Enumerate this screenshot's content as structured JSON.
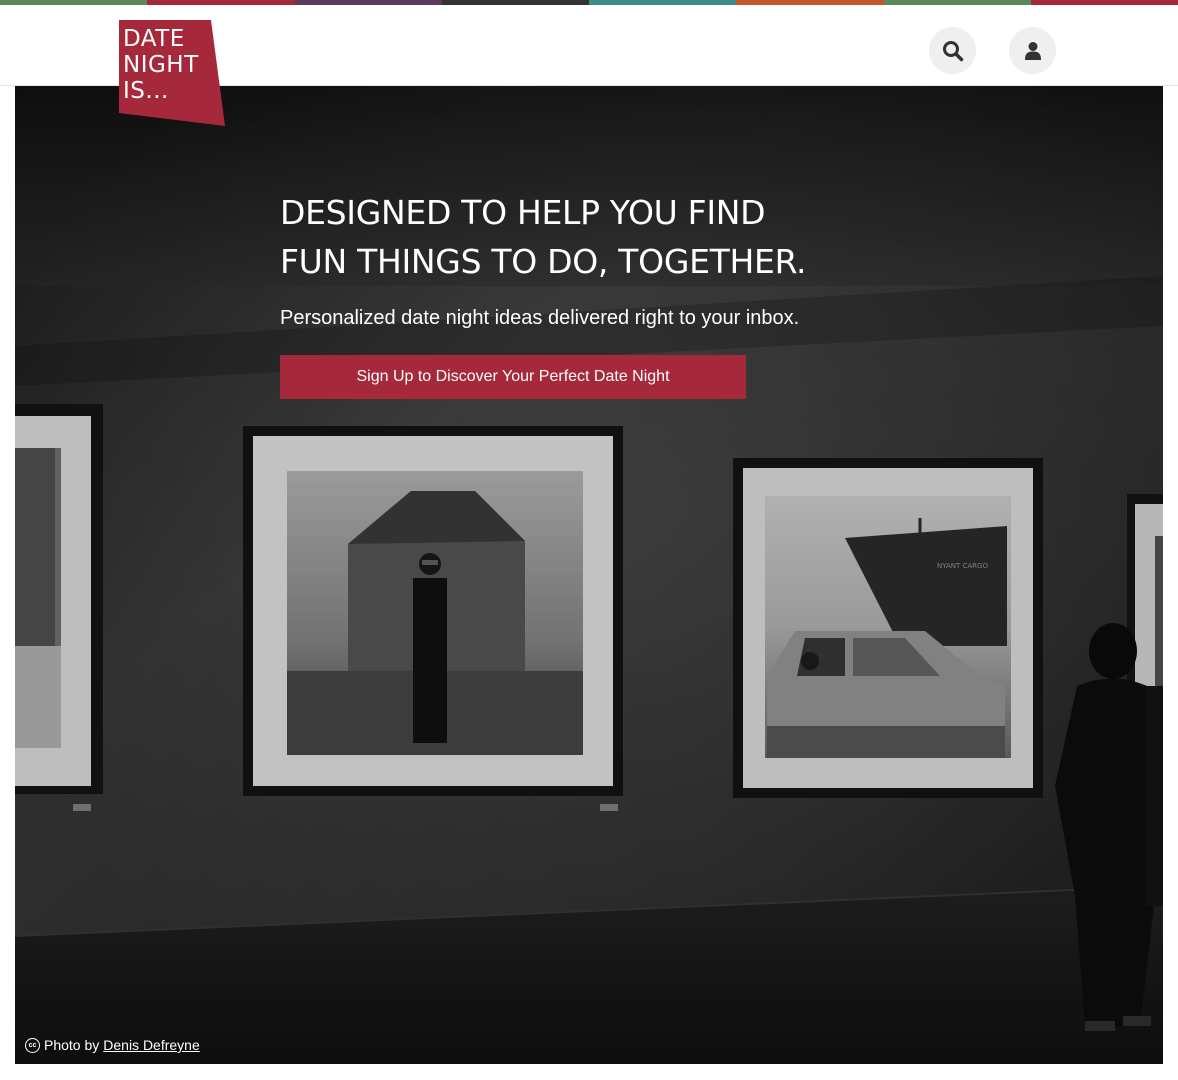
{
  "colors": {
    "brand": "#a6293b",
    "top_bar": [
      "#5a8a5c",
      "#a6293b",
      "#5c3a5c",
      "#333333",
      "#3d8c8c",
      "#c0582f",
      "#5a8a5c",
      "#a6293b"
    ]
  },
  "header": {
    "logo_text": "DATE\nNIGHT\nIS...",
    "search_icon": "search-icon",
    "user_icon": "user-icon"
  },
  "hero": {
    "title_line1": "DESIGNED TO HELP YOU FIND",
    "title_line2": "FUN THINGS TO DO, TOGETHER.",
    "subtitle": "Personalized date night ideas delivered right to your inbox.",
    "cta_label": "Sign Up to Discover Your Perfect Date Night",
    "credit_prefix": "Photo by",
    "credit_author": "Denis Defreyne",
    "credit_icon": "cc-icon"
  }
}
